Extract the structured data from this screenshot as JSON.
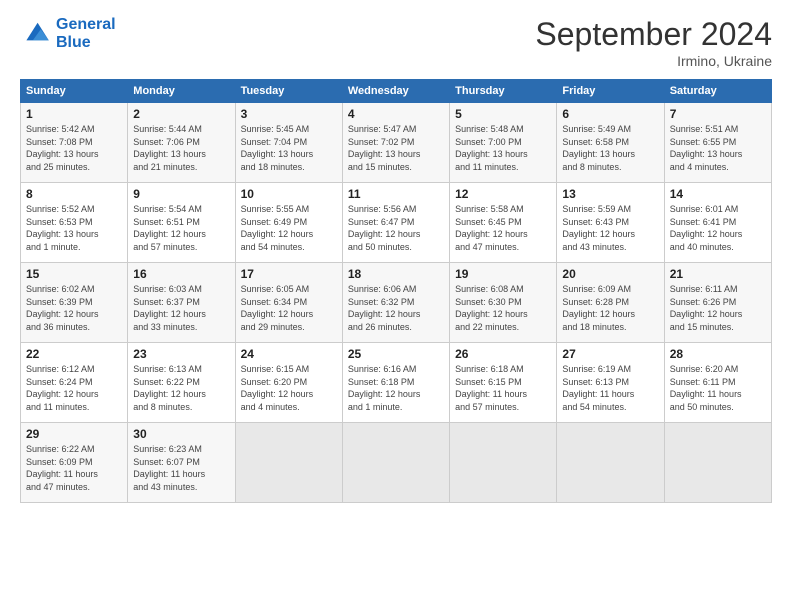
{
  "logo": {
    "line1": "General",
    "line2": "Blue"
  },
  "title": "September 2024",
  "location": "Irmino, Ukraine",
  "days_header": [
    "Sunday",
    "Monday",
    "Tuesday",
    "Wednesday",
    "Thursday",
    "Friday",
    "Saturday"
  ],
  "weeks": [
    [
      {
        "num": "1",
        "info": "Sunrise: 5:42 AM\nSunset: 7:08 PM\nDaylight: 13 hours\nand 25 minutes."
      },
      {
        "num": "2",
        "info": "Sunrise: 5:44 AM\nSunset: 7:06 PM\nDaylight: 13 hours\nand 21 minutes."
      },
      {
        "num": "3",
        "info": "Sunrise: 5:45 AM\nSunset: 7:04 PM\nDaylight: 13 hours\nand 18 minutes."
      },
      {
        "num": "4",
        "info": "Sunrise: 5:47 AM\nSunset: 7:02 PM\nDaylight: 13 hours\nand 15 minutes."
      },
      {
        "num": "5",
        "info": "Sunrise: 5:48 AM\nSunset: 7:00 PM\nDaylight: 13 hours\nand 11 minutes."
      },
      {
        "num": "6",
        "info": "Sunrise: 5:49 AM\nSunset: 6:58 PM\nDaylight: 13 hours\nand 8 minutes."
      },
      {
        "num": "7",
        "info": "Sunrise: 5:51 AM\nSunset: 6:55 PM\nDaylight: 13 hours\nand 4 minutes."
      }
    ],
    [
      {
        "num": "8",
        "info": "Sunrise: 5:52 AM\nSunset: 6:53 PM\nDaylight: 13 hours\nand 1 minute."
      },
      {
        "num": "9",
        "info": "Sunrise: 5:54 AM\nSunset: 6:51 PM\nDaylight: 12 hours\nand 57 minutes."
      },
      {
        "num": "10",
        "info": "Sunrise: 5:55 AM\nSunset: 6:49 PM\nDaylight: 12 hours\nand 54 minutes."
      },
      {
        "num": "11",
        "info": "Sunrise: 5:56 AM\nSunset: 6:47 PM\nDaylight: 12 hours\nand 50 minutes."
      },
      {
        "num": "12",
        "info": "Sunrise: 5:58 AM\nSunset: 6:45 PM\nDaylight: 12 hours\nand 47 minutes."
      },
      {
        "num": "13",
        "info": "Sunrise: 5:59 AM\nSunset: 6:43 PM\nDaylight: 12 hours\nand 43 minutes."
      },
      {
        "num": "14",
        "info": "Sunrise: 6:01 AM\nSunset: 6:41 PM\nDaylight: 12 hours\nand 40 minutes."
      }
    ],
    [
      {
        "num": "15",
        "info": "Sunrise: 6:02 AM\nSunset: 6:39 PM\nDaylight: 12 hours\nand 36 minutes."
      },
      {
        "num": "16",
        "info": "Sunrise: 6:03 AM\nSunset: 6:37 PM\nDaylight: 12 hours\nand 33 minutes."
      },
      {
        "num": "17",
        "info": "Sunrise: 6:05 AM\nSunset: 6:34 PM\nDaylight: 12 hours\nand 29 minutes."
      },
      {
        "num": "18",
        "info": "Sunrise: 6:06 AM\nSunset: 6:32 PM\nDaylight: 12 hours\nand 26 minutes."
      },
      {
        "num": "19",
        "info": "Sunrise: 6:08 AM\nSunset: 6:30 PM\nDaylight: 12 hours\nand 22 minutes."
      },
      {
        "num": "20",
        "info": "Sunrise: 6:09 AM\nSunset: 6:28 PM\nDaylight: 12 hours\nand 18 minutes."
      },
      {
        "num": "21",
        "info": "Sunrise: 6:11 AM\nSunset: 6:26 PM\nDaylight: 12 hours\nand 15 minutes."
      }
    ],
    [
      {
        "num": "22",
        "info": "Sunrise: 6:12 AM\nSunset: 6:24 PM\nDaylight: 12 hours\nand 11 minutes."
      },
      {
        "num": "23",
        "info": "Sunrise: 6:13 AM\nSunset: 6:22 PM\nDaylight: 12 hours\nand 8 minutes."
      },
      {
        "num": "24",
        "info": "Sunrise: 6:15 AM\nSunset: 6:20 PM\nDaylight: 12 hours\nand 4 minutes."
      },
      {
        "num": "25",
        "info": "Sunrise: 6:16 AM\nSunset: 6:18 PM\nDaylight: 12 hours\nand 1 minute."
      },
      {
        "num": "26",
        "info": "Sunrise: 6:18 AM\nSunset: 6:15 PM\nDaylight: 11 hours\nand 57 minutes."
      },
      {
        "num": "27",
        "info": "Sunrise: 6:19 AM\nSunset: 6:13 PM\nDaylight: 11 hours\nand 54 minutes."
      },
      {
        "num": "28",
        "info": "Sunrise: 6:20 AM\nSunset: 6:11 PM\nDaylight: 11 hours\nand 50 minutes."
      }
    ],
    [
      {
        "num": "29",
        "info": "Sunrise: 6:22 AM\nSunset: 6:09 PM\nDaylight: 11 hours\nand 47 minutes."
      },
      {
        "num": "30",
        "info": "Sunrise: 6:23 AM\nSunset: 6:07 PM\nDaylight: 11 hours\nand 43 minutes."
      },
      {
        "num": "",
        "info": ""
      },
      {
        "num": "",
        "info": ""
      },
      {
        "num": "",
        "info": ""
      },
      {
        "num": "",
        "info": ""
      },
      {
        "num": "",
        "info": ""
      }
    ]
  ]
}
